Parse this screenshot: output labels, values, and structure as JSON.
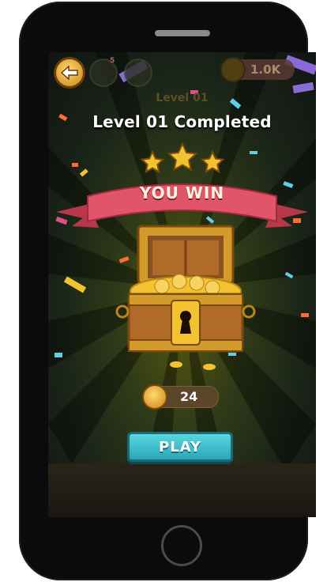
{
  "hud": {
    "badge_count": "5",
    "coin_total": "1.0K"
  },
  "level": {
    "ghost_label": "Level 01",
    "title": "Level 01 Completed",
    "stars_earned": 3,
    "stars_total": 3
  },
  "result": {
    "banner": "YOU WIN",
    "reward_coins": "24"
  },
  "actions": {
    "play_label": "PLAY"
  },
  "colors": {
    "gold": "#f2c230",
    "ribbon": "#e0556a",
    "play": "#3fc3d0",
    "chest": "#d39a2c"
  },
  "icons": {
    "back": "arrow-left-icon",
    "coin": "coin-icon",
    "star": "star-icon",
    "chest": "treasure-chest-icon"
  }
}
